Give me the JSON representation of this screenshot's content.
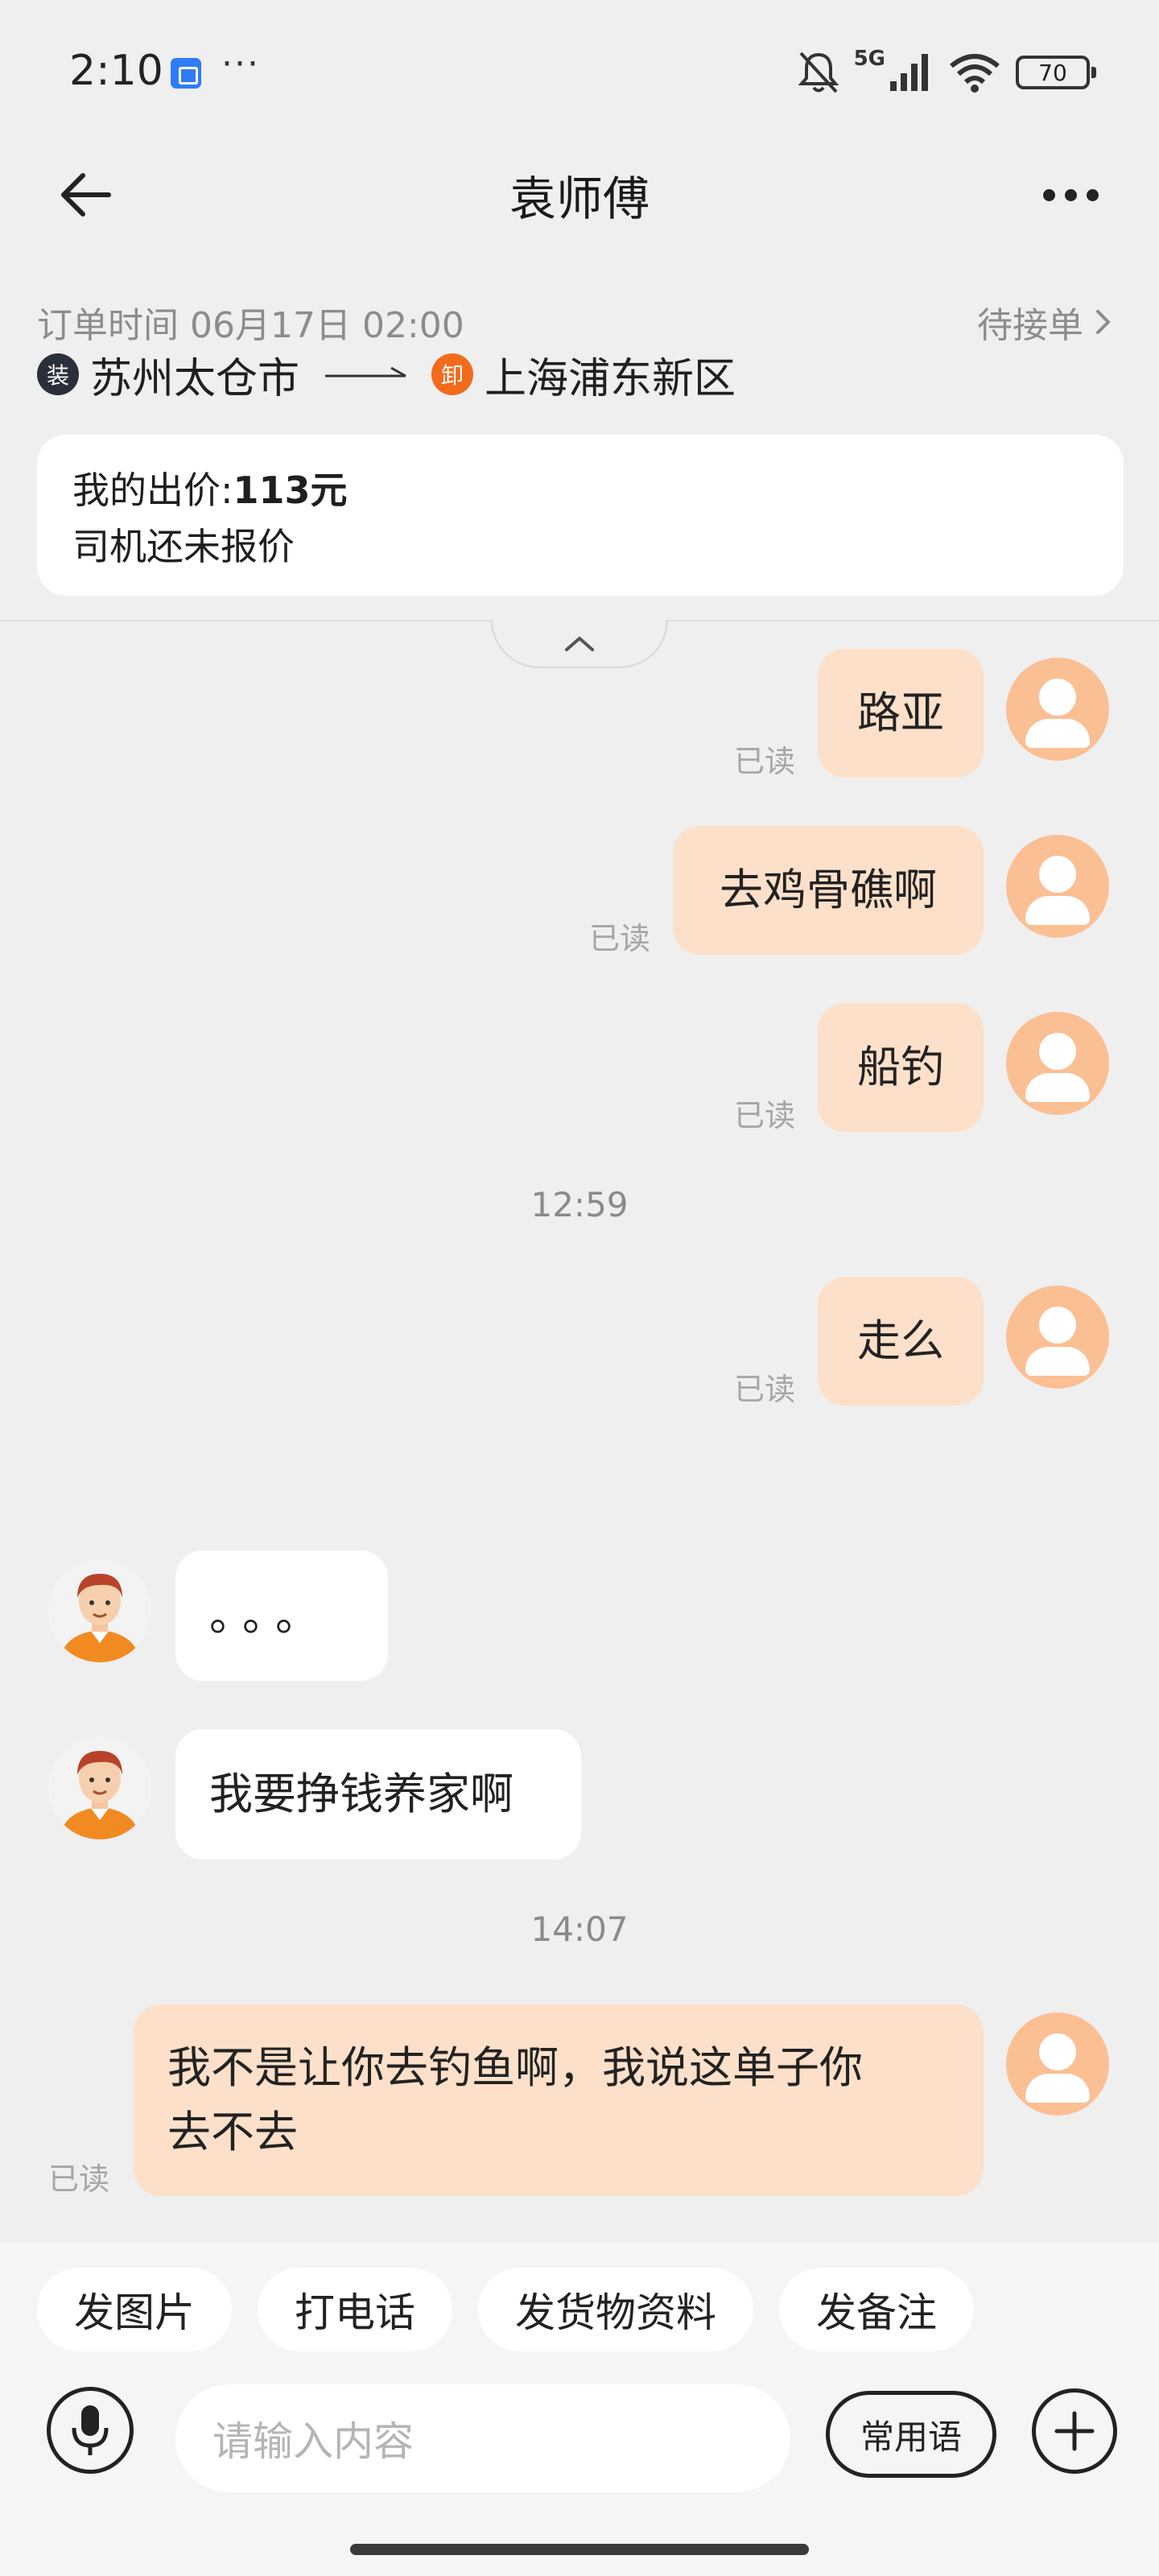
{
  "status_bar": {
    "time": "2:10",
    "extra_indicator": "···",
    "network_label": "5G",
    "battery_level": "70",
    "icons": [
      "home-app-icon",
      "mute-bell-icon",
      "signal-icon",
      "wifi-icon",
      "battery-icon"
    ]
  },
  "header": {
    "title": "袁师傅"
  },
  "order": {
    "time_label": "订单时间 06月17日 02:00",
    "status": "待接单",
    "load_badge": "装",
    "origin": "苏州太仓市",
    "unload_badge": "卸",
    "destination": "上海浦东新区"
  },
  "price_card": {
    "my_offer_label": "我的出价:",
    "my_offer_value": "113元",
    "driver_quote_status": "司机还未报价"
  },
  "messages": [
    {
      "from": "me",
      "text": "路亚",
      "read": "已读"
    },
    {
      "from": "me",
      "text": "去鸡骨礁啊",
      "read": "已读"
    },
    {
      "from": "me",
      "text": "船钓",
      "read": "已读"
    },
    {
      "type": "time",
      "text": "12:59"
    },
    {
      "from": "me",
      "text": "走么",
      "read": "已读"
    },
    {
      "from": "driver",
      "text": "。。。"
    },
    {
      "from": "driver",
      "text": "我要挣钱养家啊"
    },
    {
      "type": "time",
      "text": "14:07"
    },
    {
      "from": "me",
      "text_line1": "我不是让你去钓鱼啊，我说这单子你",
      "text_line2": "去不去",
      "read": "已读"
    }
  ],
  "quick_actions": [
    "发图片",
    "打电话",
    "发货物资料",
    "发备注"
  ],
  "composer": {
    "placeholder": "请输入内容",
    "phrases_label": "常用语"
  },
  "colors": {
    "my_bubble": "#fde0c9",
    "driver_bubble": "#ffffff",
    "my_avatar": "#fbbf94",
    "unload_badge": "#f26b1d",
    "load_badge": "#2b2f3a",
    "background": "#efefef"
  }
}
